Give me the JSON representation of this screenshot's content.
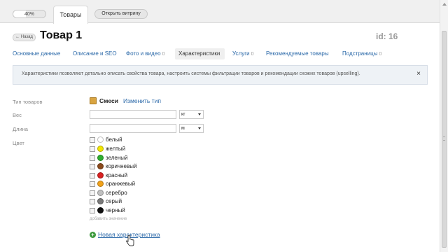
{
  "topbar": {
    "progress": {
      "label": "40%",
      "value": 0.4
    },
    "active_tab": "Товары",
    "store_button": "Открыть витрину"
  },
  "header": {
    "back_label": "← Назад",
    "title": "Товар 1",
    "id_label": "id: 16"
  },
  "nav": [
    {
      "label": "Основные данные",
      "count": ""
    },
    {
      "label": "Описание и SEO",
      "count": ""
    },
    {
      "label": "Фото и видео",
      "count": "0"
    },
    {
      "label": "Характеристики",
      "count": ""
    },
    {
      "label": "Услуги",
      "count": "0"
    },
    {
      "label": "Рекомендуемые товары",
      "count": ""
    },
    {
      "label": "Подстраницы",
      "count": "0"
    }
  ],
  "info": {
    "text": "Характеристики позволяют детально описать свойства товара, настроить системы фильтрации товаров и рекомендации схожих товаров (upselling).",
    "close": "×"
  },
  "fields": {
    "type_label": "Тип товаров",
    "type_value": "Смеси",
    "type_change": "Изменить тип",
    "weight_label": "Вес",
    "weight_value": "",
    "weight_unit": "кг",
    "length_label": "Длина",
    "length_value": "",
    "length_unit": "м",
    "color_label": "Цвет"
  },
  "colors": [
    {
      "name": "белый",
      "hex": "#ffffff"
    },
    {
      "name": "желтый",
      "hex": "#f2e600"
    },
    {
      "name": "зеленый",
      "hex": "#2fae2f"
    },
    {
      "name": "коричневый",
      "hex": "#8b4a1c"
    },
    {
      "name": "красный",
      "hex": "#d92020"
    },
    {
      "name": "оранжевый",
      "hex": "#f2a21a"
    },
    {
      "name": "серебро",
      "hex": "#c0c0c0"
    },
    {
      "name": "серый",
      "hex": "#7a7a7a"
    },
    {
      "name": "черный",
      "hex": "#111111"
    }
  ],
  "add_value": "добавить значение",
  "new_characteristic": "Новая характеристика",
  "icons": {
    "plus": "+",
    "type": "box-icon",
    "cursor": "hand-cursor-icon"
  }
}
